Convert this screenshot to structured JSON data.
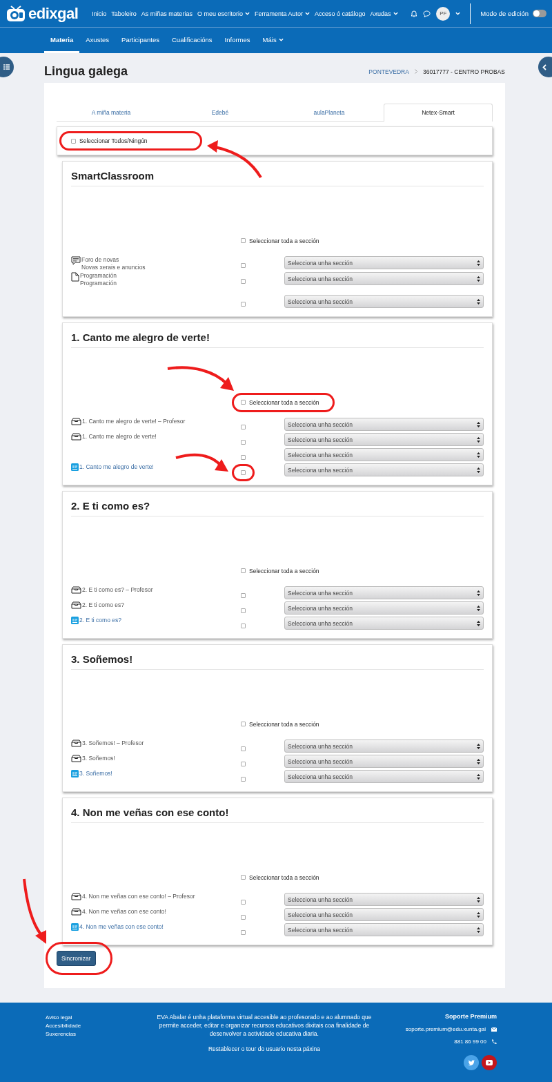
{
  "header": {
    "logo": "edixgal",
    "nav": [
      {
        "label": "Inicio",
        "dropdown": false
      },
      {
        "label": "Taboleiro",
        "dropdown": false
      },
      {
        "label": "As miñas materias",
        "dropdown": false
      },
      {
        "label": "O meu escritorio",
        "dropdown": true
      },
      {
        "label": "Ferramenta Autor",
        "dropdown": true
      },
      {
        "label": "Acceso ó catálogo",
        "dropdown": false
      },
      {
        "label": "Axudas",
        "dropdown": true
      }
    ],
    "avatar": "PF",
    "edit_mode": {
      "label": "Modo de edición",
      "on": false
    }
  },
  "course_nav": [
    {
      "label": "Materia",
      "selected": true,
      "dropdown": false
    },
    {
      "label": "Axustes",
      "selected": false,
      "dropdown": false
    },
    {
      "label": "Participantes",
      "selected": false,
      "dropdown": false
    },
    {
      "label": "Cualificacións",
      "selected": false,
      "dropdown": false
    },
    {
      "label": "Informes",
      "selected": false,
      "dropdown": false
    },
    {
      "label": "Máis",
      "selected": false,
      "dropdown": true
    }
  ],
  "page_title": "Lingua galega",
  "breadcrumb": [
    "PONTEVEDRA",
    "36017777 - CENTRO PROBAS"
  ],
  "tabs": [
    {
      "label": "A miña materia",
      "selected": false
    },
    {
      "label": "Edebé",
      "selected": false
    },
    {
      "label": "aulaPlaneta",
      "selected": false
    },
    {
      "label": "Netex-Smart",
      "selected": true
    }
  ],
  "select_all": {
    "label": "Seleccionar Todos/Ningún",
    "checked": false,
    "highlighted": true
  },
  "sections": [
    {
      "title": "SmartClassroom",
      "select_section": {
        "label": "Seleccionar toda a sección",
        "checked": false,
        "highlighted": false
      },
      "items": [
        {
          "kind": "forum",
          "title": "Foro de novas",
          "description": "Novas xerais e anuncios",
          "checked": false,
          "highlighted": false,
          "select": "Selecciona unha sección"
        },
        {
          "kind": "page",
          "title": "Programación",
          "description": "Programación",
          "checked": false,
          "highlighted": false,
          "select": "Selecciona unha sección"
        },
        {
          "kind": "blank",
          "checked": false,
          "highlighted": false,
          "select": "Selecciona unha sección"
        }
      ]
    },
    {
      "title": "1. Canto me alegro de verte!",
      "select_section": {
        "label": "Seleccionar toda a sección",
        "checked": false,
        "highlighted": true
      },
      "items": [
        {
          "kind": "package",
          "title": "1. Canto me alegro de verte! – Profesor",
          "checked": false,
          "highlighted": false,
          "select": "Selecciona unha sección"
        },
        {
          "kind": "package",
          "title": "1. Canto me alegro de verte!",
          "checked": false,
          "highlighted": false,
          "select": "Selecciona unha sección"
        },
        {
          "kind": "blank",
          "checked": false,
          "highlighted": false,
          "select": "Selecciona unha sección"
        },
        {
          "kind": "smart",
          "title": "1. Canto me alegro de verte!",
          "checked": false,
          "highlighted": true,
          "select": "Selecciona unha sección"
        }
      ]
    },
    {
      "title": "2. E ti como es?",
      "select_section": {
        "label": "Seleccionar toda a sección",
        "checked": false,
        "highlighted": false
      },
      "items": [
        {
          "kind": "package",
          "title": "2. E ti como es? – Profesor",
          "checked": false,
          "highlighted": false,
          "select": "Selecciona unha sección"
        },
        {
          "kind": "package",
          "title": "2. E ti como es?",
          "checked": false,
          "highlighted": false,
          "select": "Selecciona unha sección"
        },
        {
          "kind": "smart",
          "title": "2. E ti como es?",
          "checked": false,
          "highlighted": false,
          "select": "Selecciona unha sección"
        }
      ]
    },
    {
      "title": "3. Soñemos!",
      "select_section": {
        "label": "Seleccionar toda a sección",
        "checked": false,
        "highlighted": false
      },
      "items": [
        {
          "kind": "package",
          "title": "3. Soñemos! – Profesor",
          "checked": false,
          "highlighted": false,
          "select": "Selecciona unha sección"
        },
        {
          "kind": "package",
          "title": "3. Soñemos!",
          "checked": false,
          "highlighted": false,
          "select": "Selecciona unha sección"
        },
        {
          "kind": "smart",
          "title": "3. Soñemos!",
          "checked": false,
          "highlighted": false,
          "select": "Selecciona unha sección"
        }
      ]
    },
    {
      "title": "4. Non me veñas con ese conto!",
      "select_section": {
        "label": "Seleccionar toda a sección",
        "checked": false,
        "highlighted": false
      },
      "items": [
        {
          "kind": "package",
          "title": "4. Non me veñas con ese conto! – Profesor",
          "checked": false,
          "highlighted": false,
          "select": "Selecciona unha sección"
        },
        {
          "kind": "package",
          "title": "4. Non me veñas con ese conto!",
          "checked": false,
          "highlighted": false,
          "select": "Selecciona unha sección"
        },
        {
          "kind": "smart",
          "title": "4. Non me veñas con ese conto!",
          "checked": false,
          "highlighted": false,
          "select": "Selecciona unha sección"
        }
      ]
    }
  ],
  "sync_button": {
    "label": "Sincronizar",
    "highlighted": true
  },
  "footer": {
    "links": [
      "Aviso legal",
      "Accesibilidade",
      "Suxerencias"
    ],
    "description": "EVA Abalar é unha plataforma virtual accesible ao profesorado e ao alumnado que permite acceder, editar e organizar recursos educativos dixitais coa finalidade de desenvolver a actividade educativa diaria.",
    "tour_link": "Restablecer o tour do usuario nesta páxina",
    "support_title": "Soporte Premium",
    "email": "soporte.premium@edu.xunta.gal",
    "phone": "881 86 99 00"
  }
}
